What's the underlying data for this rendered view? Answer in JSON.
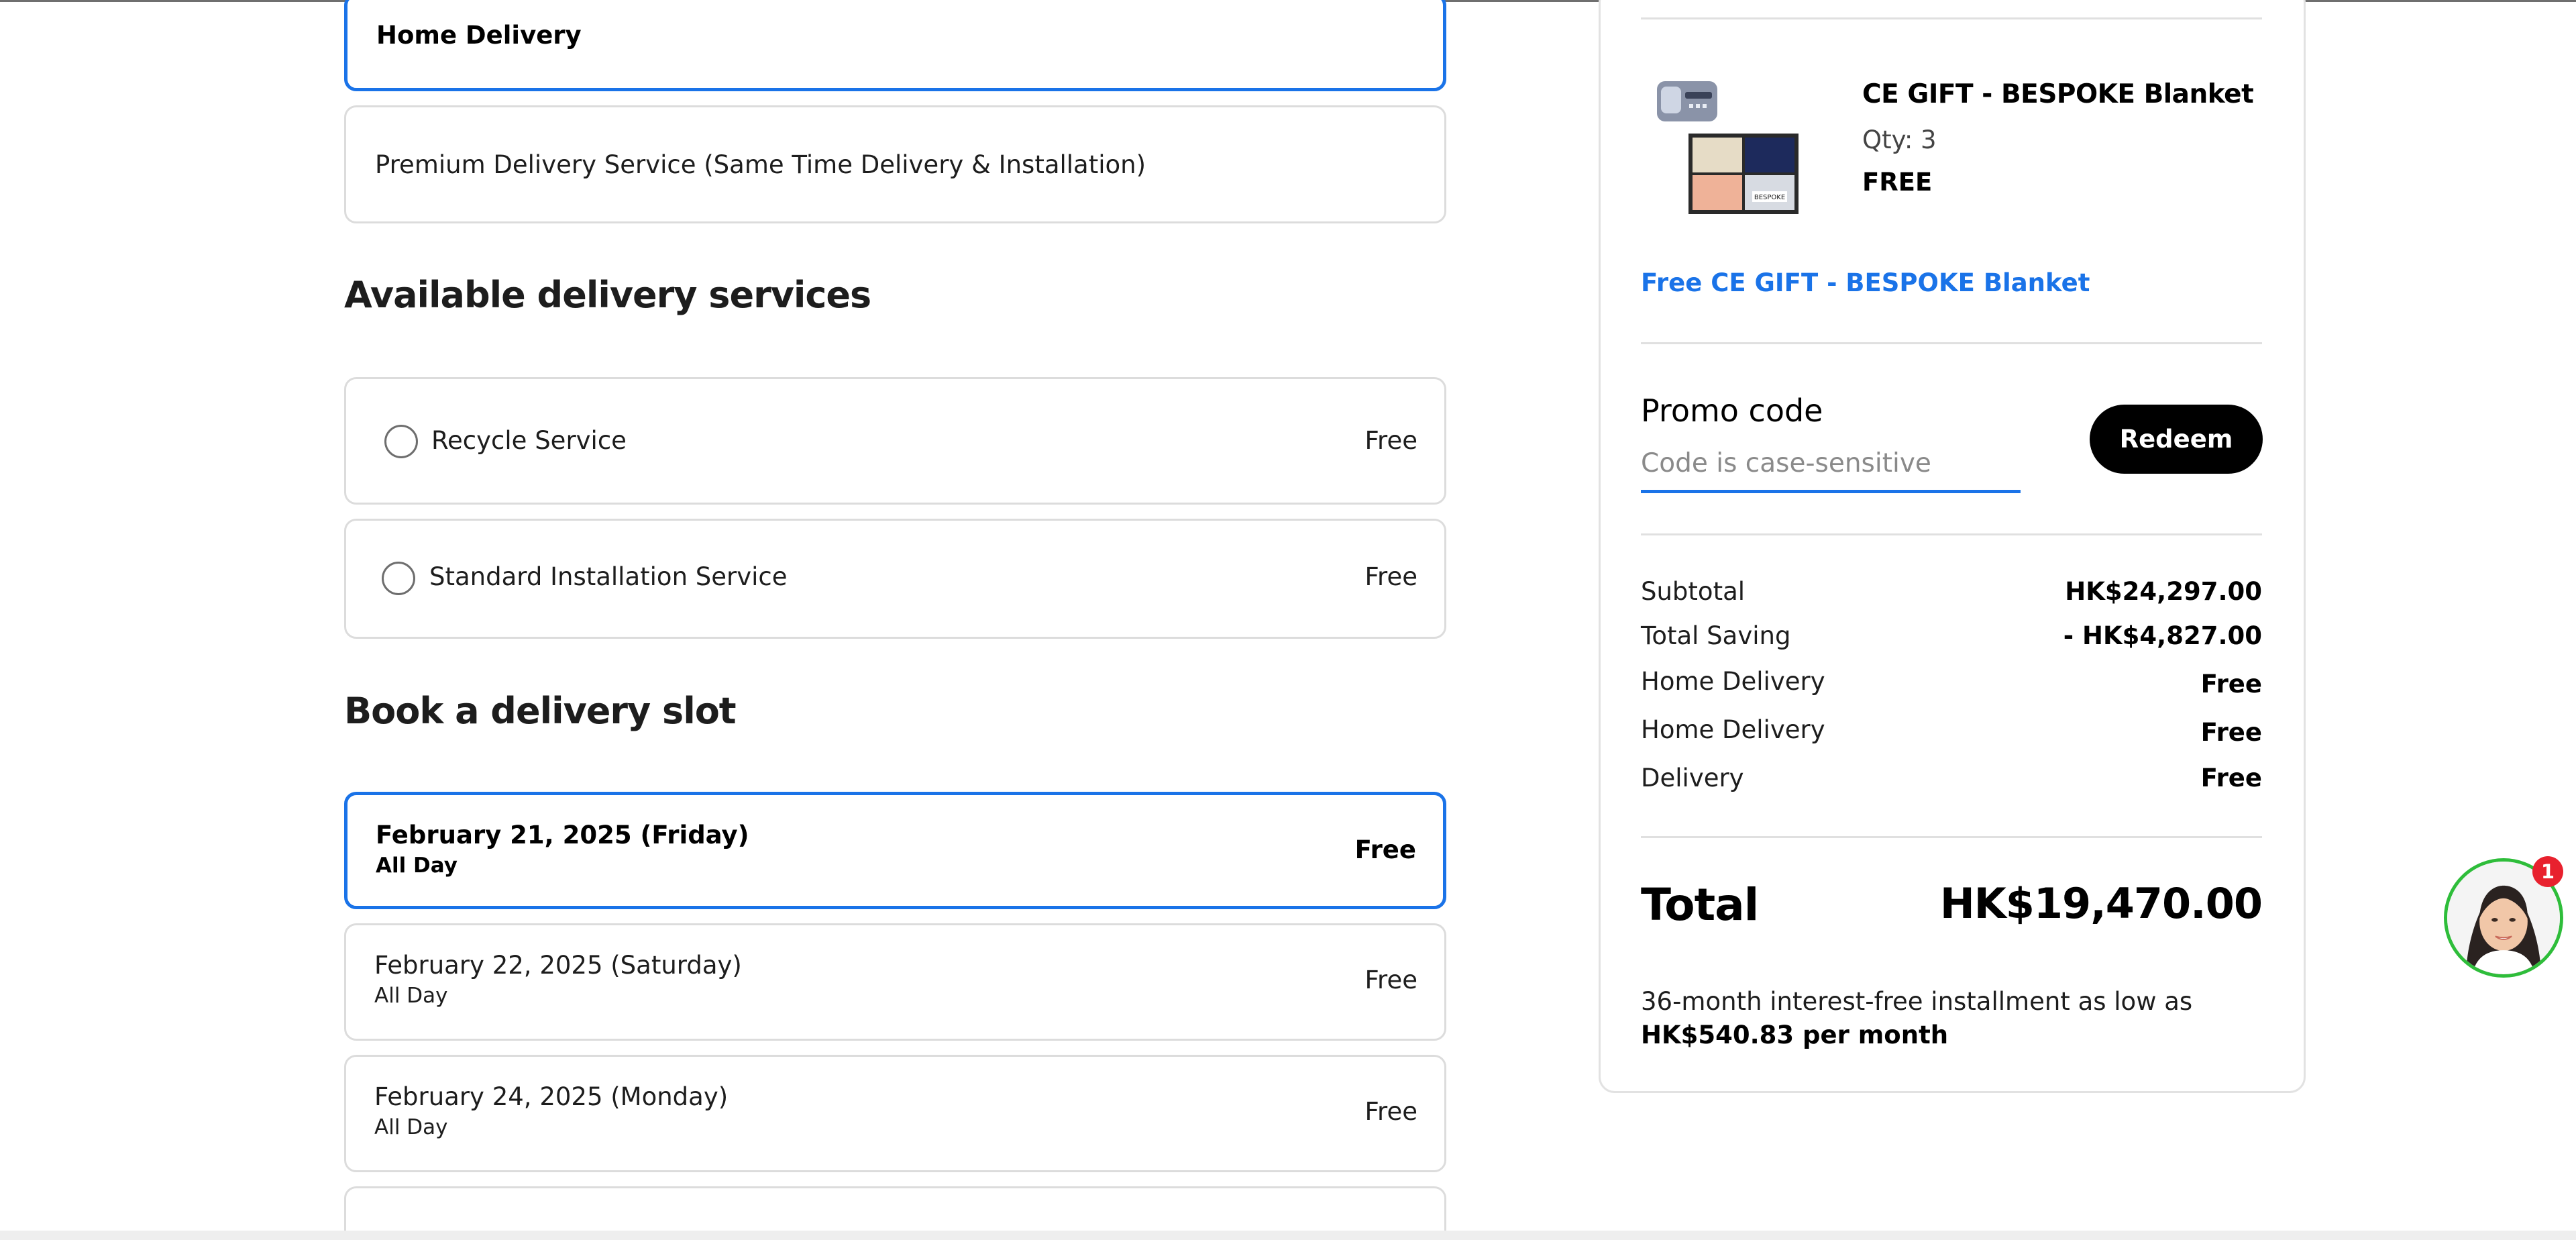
{
  "delivery_methods": [
    {
      "label": "Home Delivery",
      "selected": true
    },
    {
      "label": "Premium Delivery Service (Same Time Delivery & Installation)",
      "selected": false
    }
  ],
  "services": {
    "heading": "Available delivery services",
    "items": [
      {
        "label": "Recycle Service",
        "price": "Free",
        "checked": false
      },
      {
        "label": "Standard Installation Service",
        "price": "Free",
        "checked": false
      }
    ]
  },
  "slots": {
    "heading": "Book a delivery slot",
    "items": [
      {
        "date": "February 21, 2025 (Friday)",
        "time": "All Day",
        "price": "Free",
        "selected": true
      },
      {
        "date": "February 22, 2025 (Saturday)",
        "time": "All Day",
        "price": "Free",
        "selected": false
      },
      {
        "date": "February 24, 2025 (Monday)",
        "time": "All Day",
        "price": "Free",
        "selected": false
      }
    ]
  },
  "summary": {
    "gift": {
      "name": "CE GIFT - BESPOKE Blanket",
      "qty": "Qty: 3",
      "price": "FREE",
      "image_logo_text": "BESPOKE"
    },
    "free_gift_link": "Free CE GIFT - BESPOKE Blanket",
    "promo": {
      "title": "Promo code",
      "placeholder": "Code is case-sensitive",
      "value": "",
      "button": "Redeem"
    },
    "rows": [
      {
        "label": "Subtotal",
        "value": "HK$24,297.00"
      },
      {
        "label": "Total Saving",
        "value": "- HK$4,827.00"
      },
      {
        "label": "Home Delivery",
        "value": "Free"
      },
      {
        "label": "Home Delivery",
        "value": "Free"
      },
      {
        "label": "Delivery",
        "value": "Free"
      }
    ],
    "total_label": "Total",
    "total_value": "HK$19,470.00",
    "installment_text": "36-month interest-free installment as low as ",
    "installment_amount": "HK$540.83 per month"
  },
  "chat": {
    "badge": "1"
  },
  "colors": {
    "accent": "#1a73e8",
    "chat_ring": "#2ebd3a",
    "badge": "#e8212e",
    "button": "#000000"
  }
}
